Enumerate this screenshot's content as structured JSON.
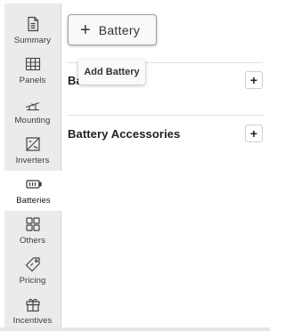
{
  "sidebar": {
    "items": [
      {
        "label": "Summary",
        "icon": "document-icon",
        "active": false
      },
      {
        "label": "Panels",
        "icon": "solar-panel-icon",
        "active": false
      },
      {
        "label": "Mounting",
        "icon": "mounting-icon",
        "active": false
      },
      {
        "label": "Inverters",
        "icon": "inverter-icon",
        "active": false
      },
      {
        "label": "Batteries",
        "icon": "battery-icon",
        "active": true
      },
      {
        "label": "Others",
        "icon": "grid-icon",
        "active": false
      },
      {
        "label": "Pricing",
        "icon": "price-tag-icon",
        "active": false
      },
      {
        "label": "Incentives",
        "icon": "gift-icon",
        "active": false
      }
    ]
  },
  "main": {
    "add_button": {
      "plus": "+",
      "label": "Battery"
    },
    "tooltip": "Add Battery",
    "sections": [
      {
        "title": "Batteries",
        "add": "+"
      },
      {
        "title": "Battery Accessories",
        "add": "+"
      }
    ]
  }
}
